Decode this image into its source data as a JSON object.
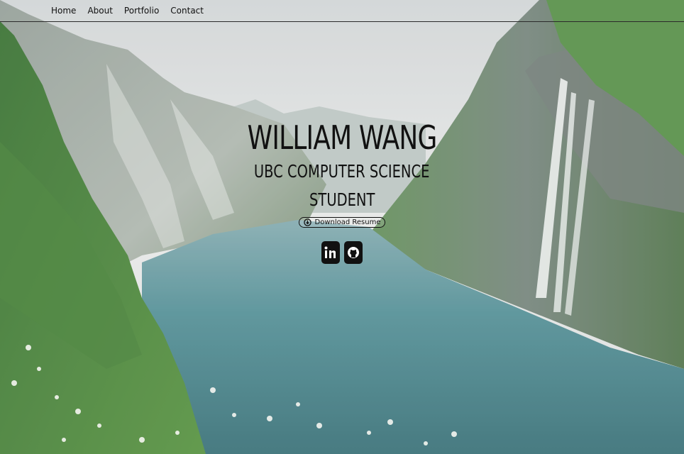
{
  "nav": {
    "items": [
      {
        "label": "Home"
      },
      {
        "label": "About"
      },
      {
        "label": "Portfolio"
      },
      {
        "label": "Contact"
      }
    ]
  },
  "hero": {
    "name": "WILLIAM WANG",
    "subtitle_line1": "UBC COMPUTER SCIENCE",
    "subtitle_line2": "STUDENT",
    "resume_label": "Download Resume",
    "socials": [
      {
        "icon": "linkedin-icon"
      },
      {
        "icon": "github-icon"
      }
    ]
  },
  "colors": {
    "text": "#111111",
    "sky": "#dcdfe0",
    "water": "#3f7f86",
    "foliage": "#4f8a3a"
  }
}
